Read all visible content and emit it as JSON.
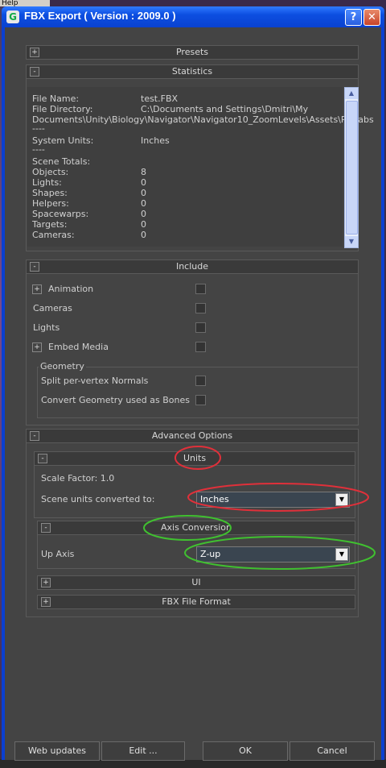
{
  "background": {
    "help_label": "Help"
  },
  "window": {
    "title": "FBX Export ( Version : 2009.0 )",
    "help_button": "?",
    "close_button": "✕"
  },
  "presets": {
    "label": "Presets",
    "toggle": "+"
  },
  "statistics": {
    "label": "Statistics",
    "toggle": "-",
    "file_name_label": "File Name:",
    "file_name_value": "test.FBX",
    "file_dir_label": "File Directory:",
    "file_dir_line1": "C:\\Documents and Settings\\Dmitri\\My",
    "file_dir_line2": "Documents\\Unity\\Biology\\Navigator\\Navigator10_ZoomLevels\\Assets\\Prefabs",
    "sep1": "----",
    "system_units_label": "System Units:",
    "system_units_value": "Inches",
    "sep2": "----",
    "scene_totals_label": "Scene Totals:",
    "rows": [
      {
        "label": "Objects:",
        "value": "8"
      },
      {
        "label": "Lights:",
        "value": "0"
      },
      {
        "label": "Shapes:",
        "value": "0"
      },
      {
        "label": "Helpers:",
        "value": "0"
      },
      {
        "label": "Spacewarps:",
        "value": "0"
      },
      {
        "label": "Targets:",
        "value": "0"
      },
      {
        "label": "Cameras:",
        "value": "0"
      }
    ]
  },
  "include": {
    "label": "Include",
    "toggle": "-",
    "animation": "Animation",
    "cameras": "Cameras",
    "lights": "Lights",
    "embed_media": "Embed Media",
    "geometry_label": "Geometry",
    "split_normals": "Split per-vertex Normals",
    "convert_bones": "Convert Geometry used as Bones",
    "plus": "+"
  },
  "advanced": {
    "label": "Advanced Options",
    "toggle": "-",
    "units": {
      "label": "Units",
      "toggle": "-",
      "scale_factor": "Scale Factor: 1.0",
      "converted_label": "Scene units converted to:",
      "converted_value": "Inches"
    },
    "axis": {
      "label": "Axis Conversion",
      "toggle": "-",
      "up_axis_label": "Up Axis",
      "up_axis_value": "Z-up"
    },
    "ui": {
      "label": "UI",
      "toggle": "+"
    },
    "fbx_format": {
      "label": "FBX File Format",
      "toggle": "+"
    }
  },
  "buttons": {
    "web_updates": "Web updates",
    "edit": "Edit ...",
    "ok": "OK",
    "cancel": "Cancel"
  },
  "colors": {
    "titlebar": "#0c4ee0",
    "panel_bg": "#444444",
    "annotation_red": "#e0303a",
    "annotation_green": "#40c030"
  }
}
